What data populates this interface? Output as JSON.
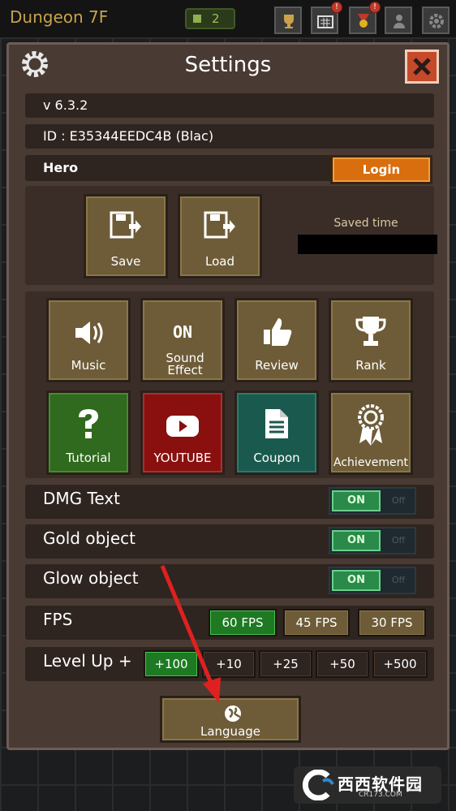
{
  "hud": {
    "dungeon_title": "Dungeon 7F",
    "counter": "2",
    "badge_1": "!",
    "badge_2": "!"
  },
  "settings": {
    "title": "Settings",
    "version": "v 6.3.2",
    "id_text": "ID : E35344EEDC4B (Blac)",
    "hero_label": "Hero",
    "login_label": "Login",
    "save_label": "Save",
    "load_label": "Load",
    "saved_time_label": "Saved time",
    "grid": [
      {
        "label": "Music",
        "icon": "speaker-icon"
      },
      {
        "label": "Sound Effect",
        "icon": "on-text-icon",
        "icon_text": "ON"
      },
      {
        "label": "Review",
        "icon": "thumbs-up-icon"
      },
      {
        "label": "Rank",
        "icon": "trophy-icon"
      },
      {
        "label": "Tutorial",
        "icon": "question-icon"
      },
      {
        "label": "YOUTUBE",
        "icon": "play-icon"
      },
      {
        "label": "Coupon",
        "icon": "document-icon"
      },
      {
        "label": "Achievement",
        "icon": "ribbon-icon"
      }
    ],
    "toggles": [
      {
        "label": "DMG Text",
        "on": "ON",
        "off": "Off"
      },
      {
        "label": "Gold object",
        "on": "ON",
        "off": "Off"
      },
      {
        "label": "Glow object",
        "on": "ON",
        "off": "Off"
      }
    ],
    "fps": {
      "label": "FPS",
      "options": [
        "60 FPS",
        "45 FPS",
        "30 FPS"
      ],
      "selected": "60 FPS"
    },
    "level_up": {
      "label": "Level Up +",
      "options": [
        "+100",
        "+10",
        "+25",
        "+50",
        "+500"
      ],
      "selected": "+100"
    },
    "language_label": "Language"
  },
  "watermark": {
    "text": "西西软件园",
    "sub": "CR173.COM"
  },
  "colors": {
    "panel": "#4a3a34",
    "tile": "#6e5c38",
    "login": "#d86e0e",
    "toggle_on": "#2a8a4a",
    "selected": "#1e7a22",
    "tutorial": "#2f6a1e",
    "youtube": "#8a1010",
    "coupon": "#1a5a4e",
    "annotation_arrow": "#e02020"
  }
}
